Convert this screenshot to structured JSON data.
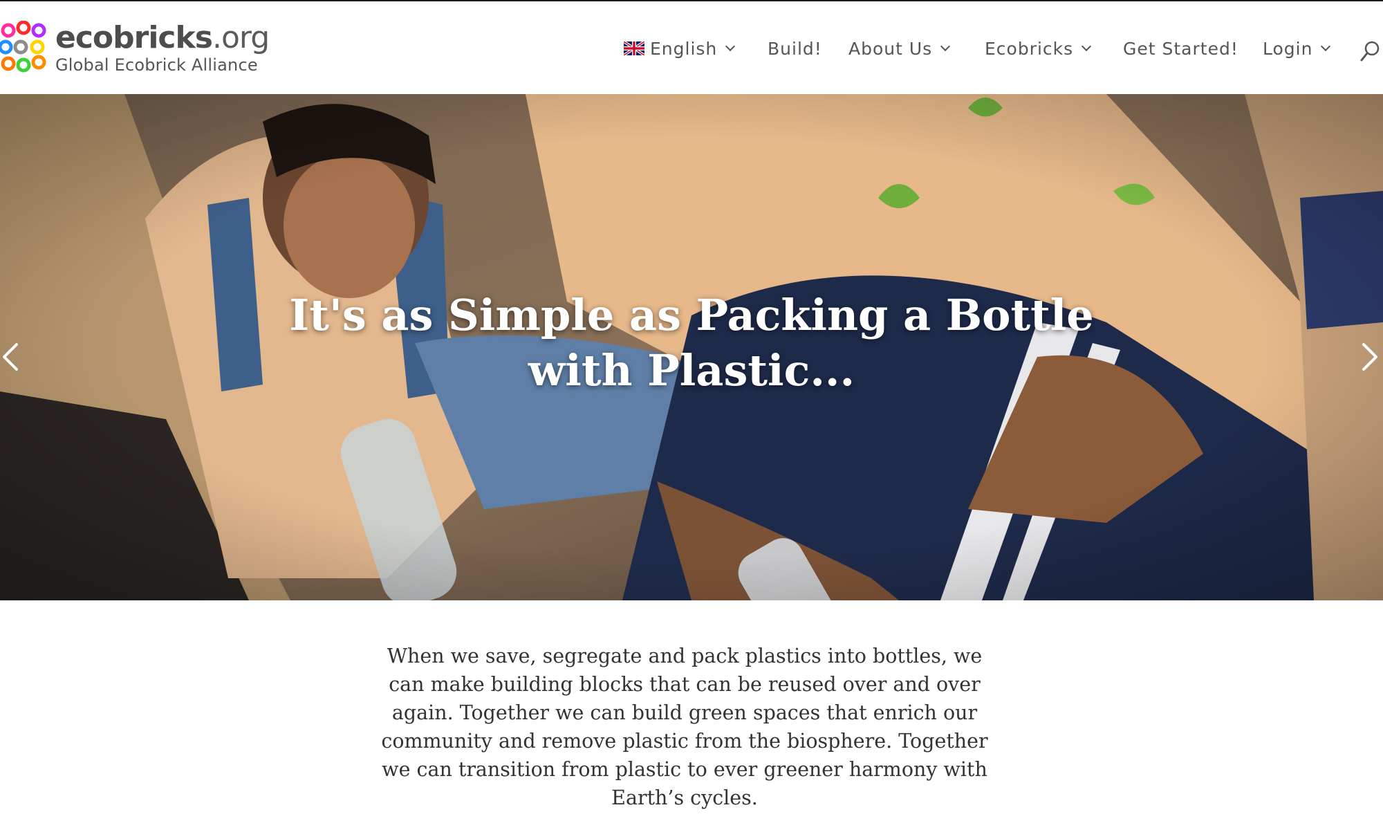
{
  "brand": {
    "name_main": "ecobricks",
    "name_tld": ".org",
    "tagline": "Global Ecobrick Alliance",
    "colors": [
      "#ff2fa0",
      "#ff2a2a",
      "#b22cff",
      "#1e90ff",
      "#8c8c8c",
      "#ffd400",
      "#ff7a00",
      "#39d339",
      "#ff8c00"
    ]
  },
  "nav": {
    "language": {
      "label": "English",
      "icon": "uk-flag-icon"
    },
    "build": "Build!",
    "about": "About Us",
    "ecobricks": "Ecobricks",
    "get_started": "Get Started!",
    "login": "Login",
    "search_icon": "search-icon"
  },
  "hero": {
    "title_line1": "It's as Simple as Packing a Bottle",
    "title_line2": "with Plastic...",
    "slide_count": 7,
    "active_slide": 2,
    "prev_icon": "chevron-left-icon",
    "next_icon": "chevron-right-icon"
  },
  "intro": {
    "text": "When we save, segregate and pack plastics into bottles, we can make building blocks that can be reused over and over again. Together we can build green spaces that enrich our community and remove plastic from the biosphere.  Together we can transition from plastic to ever greener harmony with Earth’s cycles."
  }
}
